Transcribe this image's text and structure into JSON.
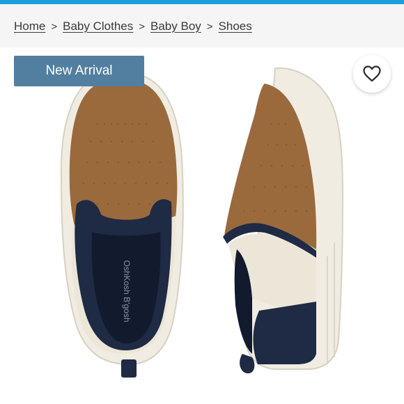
{
  "breadcrumb": {
    "items": [
      "Home",
      "Baby Clothes",
      "Baby Boy",
      "Shoes"
    ],
    "separator": ">"
  },
  "product": {
    "badge_label": "New Arrival",
    "favorite_icon": "heart-icon",
    "image_alt": "slip-on shoes",
    "insole_brand": "OshKosh B'gosh",
    "colors": {
      "leather": "#9a6a3d",
      "canvas": "#ece6d9",
      "trim": "#1f2a44",
      "sole": "#f1ece2",
      "badge": "#527f9f",
      "accent_bar": "#1aa0d8"
    }
  }
}
